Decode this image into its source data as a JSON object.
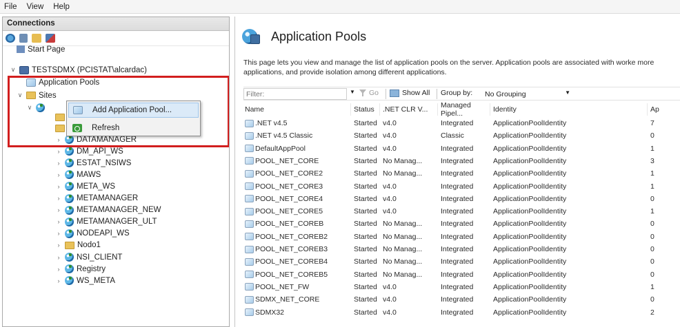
{
  "menu": [
    "File",
    "View",
    "Help"
  ],
  "connections": {
    "header": "Connections",
    "tree": {
      "start_page": "Start Page",
      "server": "TESTSDMX (PCISTAT\\alcardac)",
      "app_pools": "Application Pools",
      "sites": "Sites",
      "site_items": [
        "DATAMANAGER",
        "DM_API_WS",
        "ESTAT_NSIWS",
        "MAWS",
        "META_WS",
        "METAMANAGER",
        "METAMANAGER_NEW",
        "METAMANAGER_ULT",
        "NODEAPI_WS",
        "Nodo1",
        "NSI_CLIENT",
        "Registry",
        "WS_META"
      ]
    }
  },
  "context_menu": {
    "add_pool": "Add Application Pool...",
    "refresh": "Refresh"
  },
  "main": {
    "title": "Application Pools",
    "description": "This page lets you view and manage the list of application pools on the server. Application pools are associated with worke more applications, and provide isolation among different applications."
  },
  "filterbar": {
    "filter_label": "Filter:",
    "go": "Go",
    "show_all": "Show All",
    "group_by_label": "Group by:",
    "group_by_value": "No Grouping"
  },
  "table": {
    "headers": [
      "Name",
      "Status",
      ".NET CLR V...",
      "Managed Pipel...",
      "Identity",
      "Ap"
    ],
    "rows": [
      [
        ".NET v4.5",
        "Started",
        "v4.0",
        "Integrated",
        "ApplicationPoolIdentity",
        "7"
      ],
      [
        ".NET v4.5 Classic",
        "Started",
        "v4.0",
        "Classic",
        "ApplicationPoolIdentity",
        "0"
      ],
      [
        "DefaultAppPool",
        "Started",
        "v4.0",
        "Integrated",
        "ApplicationPoolIdentity",
        "1"
      ],
      [
        "POOL_NET_CORE",
        "Started",
        "No Manag...",
        "Integrated",
        "ApplicationPoolIdentity",
        "3"
      ],
      [
        "POOL_NET_CORE2",
        "Started",
        "No Manag...",
        "Integrated",
        "ApplicationPoolIdentity",
        "1"
      ],
      [
        "POOL_NET_CORE3",
        "Started",
        "v4.0",
        "Integrated",
        "ApplicationPoolIdentity",
        "1"
      ],
      [
        "POOL_NET_CORE4",
        "Started",
        "v4.0",
        "Integrated",
        "ApplicationPoolIdentity",
        "0"
      ],
      [
        "POOL_NET_CORE5",
        "Started",
        "v4.0",
        "Integrated",
        "ApplicationPoolIdentity",
        "1"
      ],
      [
        "POOL_NET_COREB",
        "Started",
        "No Manag...",
        "Integrated",
        "ApplicationPoolIdentity",
        "0"
      ],
      [
        "POOL_NET_COREB2",
        "Started",
        "No Manag...",
        "Integrated",
        "ApplicationPoolIdentity",
        "0"
      ],
      [
        "POOL_NET_COREB3",
        "Started",
        "No Manag...",
        "Integrated",
        "ApplicationPoolIdentity",
        "0"
      ],
      [
        "POOL_NET_COREB4",
        "Started",
        "No Manag...",
        "Integrated",
        "ApplicationPoolIdentity",
        "0"
      ],
      [
        "POOL_NET_COREB5",
        "Started",
        "No Manag...",
        "Integrated",
        "ApplicationPoolIdentity",
        "0"
      ],
      [
        "POOL_NET_FW",
        "Started",
        "v4.0",
        "Integrated",
        "ApplicationPoolIdentity",
        "1"
      ],
      [
        "SDMX_NET_CORE",
        "Started",
        "v4.0",
        "Integrated",
        "ApplicationPoolIdentity",
        "0"
      ],
      [
        "SDMX32",
        "Started",
        "v4.0",
        "Integrated",
        "ApplicationPoolIdentity",
        "2"
      ]
    ]
  },
  "colors": {
    "highlight_box": "#d21e1e",
    "menu_hover": "#dbeaf8"
  }
}
